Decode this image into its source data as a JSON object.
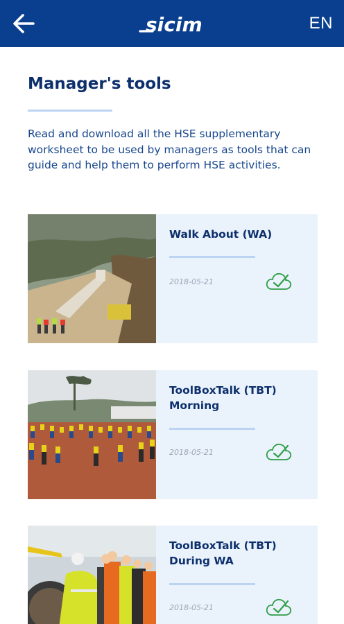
{
  "header": {
    "back_icon": "arrow-left-icon",
    "logo_text": "sicim",
    "language": "EN",
    "bg_color": "#0a3f8f"
  },
  "page": {
    "title": "Manager's tools",
    "description": "Read and download all the HSE supplementary worksheet to be used by managers as tools that can guide and help them to perform HSE activities."
  },
  "cards": [
    {
      "title": "Walk About (WA)",
      "date": "2018-05-21",
      "status_icon": "check-cloud-icon"
    },
    {
      "title": "ToolBoxTalk (TBT) Morning",
      "date": "2018-05-21",
      "status_icon": "check-cloud-icon"
    },
    {
      "title": "ToolBoxTalk (TBT) During WA",
      "date": "2018-05-21",
      "status_icon": "check-cloud-icon"
    }
  ],
  "colors": {
    "title": "#0d2f6b",
    "text": "#17468c",
    "card_bg": "#eaf3fc",
    "check": "#2f9e47"
  }
}
